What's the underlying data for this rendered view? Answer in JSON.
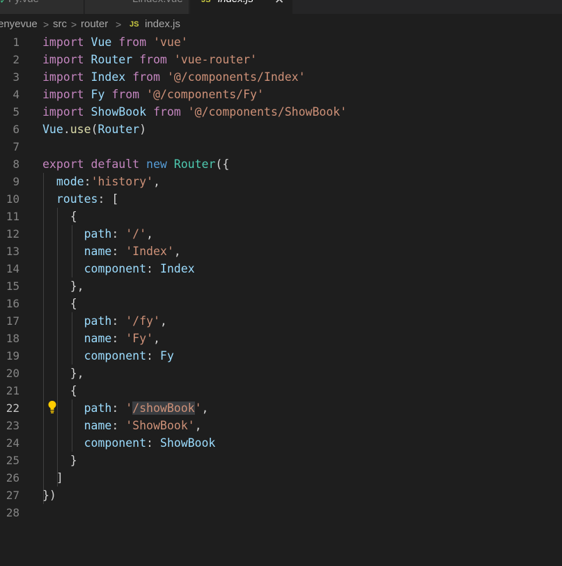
{
  "tabs": [
    {
      "label": "Fy.vue"
    },
    {
      "label": "Lindex.vue"
    },
    {
      "label": "index.js",
      "icon_text": "JS",
      "close": "✕"
    }
  ],
  "breadcrumb": {
    "items": [
      "enyevue",
      "src",
      "router",
      "index.js"
    ],
    "separator": ">",
    "file_icon_text": "JS"
  },
  "editor": {
    "line_numbers": [
      "1",
      "2",
      "3",
      "4",
      "5",
      "6",
      "7",
      "8",
      "9",
      "10",
      "11",
      "12",
      "13",
      "14",
      "15",
      "16",
      "17",
      "18",
      "19",
      "20",
      "21",
      "22",
      "23",
      "24",
      "25",
      "26",
      "27",
      "28"
    ],
    "active_line": 22
  },
  "colors": {
    "background": "#1e1e1e",
    "keyword": "#c586c0",
    "storage": "#569cd6",
    "variable": "#9cdcfe",
    "class": "#4ec9b0",
    "function": "#dcdcaa",
    "string": "#ce9178"
  },
  "icons": {
    "lightbulb": "lightbulb-icon",
    "vue": "vue-file-icon",
    "js": "js-file-icon",
    "close": "close-icon"
  }
}
